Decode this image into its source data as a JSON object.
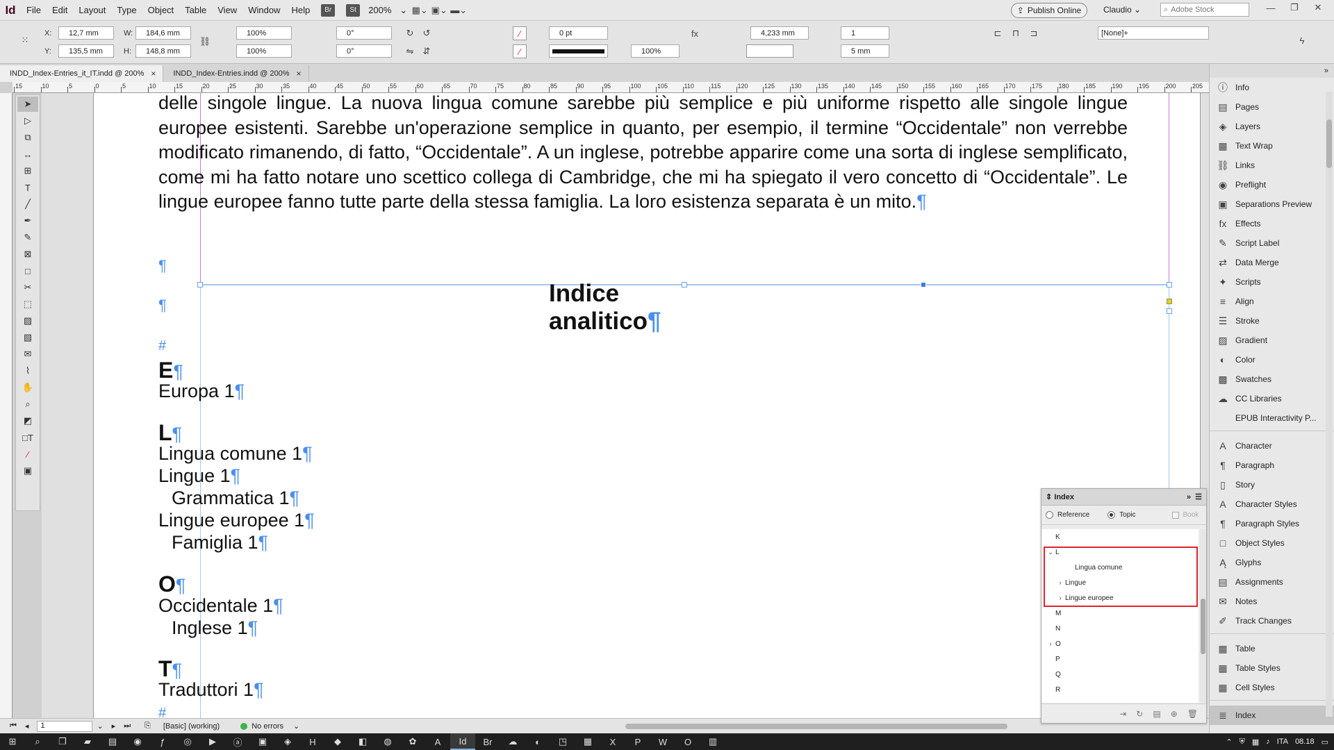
{
  "app": {
    "logo": "Id"
  },
  "menu": [
    "File",
    "Edit",
    "Layout",
    "Type",
    "Object",
    "Table",
    "View",
    "Window",
    "Help"
  ],
  "menubar": {
    "badge_br": "Br",
    "badge_st": "St",
    "zoom": "200%",
    "publish": "Publish Online",
    "user": "Claudio",
    "stock_placeholder": "Adobe Stock"
  },
  "control": {
    "x_label": "X:",
    "x": "12,7 mm",
    "y_label": "Y:",
    "y": "135,5 mm",
    "w_label": "W:",
    "w": "184,6 mm",
    "h_label": "H:",
    "h": "148,8 mm",
    "scale_x": "100%",
    "scale_y": "100%",
    "rotate": "0°",
    "shear": "0°",
    "stroke_weight": "0 pt",
    "opacity": "100%",
    "gutter": "4,233 mm",
    "columns": "1",
    "col_gap": "5 mm",
    "object_style": "[None]+"
  },
  "tabs": [
    {
      "label": "INDD_Index-Entries_it_IT.indd @ 200%",
      "close": "×"
    },
    {
      "label": "INDD_Index-Entries.indd @ 200%",
      "close": "×"
    }
  ],
  "ruler": [
    "15",
    "10",
    "5",
    "0",
    "5",
    "10",
    "15",
    "20",
    "25",
    "30",
    "35",
    "40",
    "45",
    "50",
    "55",
    "60",
    "65",
    "70",
    "75",
    "80",
    "85",
    "90",
    "95",
    "100",
    "105",
    "110",
    "115",
    "120",
    "125",
    "130",
    "135",
    "140",
    "145",
    "150",
    "155",
    "160",
    "165",
    "170",
    "175",
    "180",
    "185",
    "190",
    "195",
    "200",
    "205",
    "210"
  ],
  "document": {
    "paragraph": "delle singole lingue. La nuova lingua comune sarebbe più semplice e più uniforme rispetto alle singole lingue europee esistenti. Sarebbe un'operazione semplice in quanto, per esempio, il termine “Occidentale” non verrebbe modificato rimanendo, di fatto, “Occidentale”. A un inglese, potrebbe apparire come una sorta di inglese semplificato, come mi ha fatto notare uno scettico collega di Cambridge, che mi ha spiegato il vero concetto di “Occidentale”. Le lingue europee fanno tutte parte della stessa famiglia. La loro esistenza separata è un mito.",
    "pilcrow": "¶",
    "hash": "#",
    "index_title": "Indice analitico",
    "entries": [
      {
        "text": "E",
        "type": "letter"
      },
      {
        "text": "Europa  1",
        "type": "entry"
      },
      {
        "text": "L",
        "type": "letter"
      },
      {
        "text": "Lingua comune  1",
        "type": "entry"
      },
      {
        "text": "Lingue  1",
        "type": "entry"
      },
      {
        "text": "Grammatica  1",
        "type": "sub"
      },
      {
        "text": "Lingue europee  1",
        "type": "entry"
      },
      {
        "text": "Famiglia  1",
        "type": "sub"
      },
      {
        "text": "O",
        "type": "letter"
      },
      {
        "text": "Occidentale  1",
        "type": "entry"
      },
      {
        "text": "Inglese  1",
        "type": "sub"
      },
      {
        "text": "T",
        "type": "letter"
      },
      {
        "text": "Traduttori  1",
        "type": "entry"
      }
    ]
  },
  "status": {
    "page": "1",
    "style": "[Basic] (working)",
    "errors": "No errors"
  },
  "dock": {
    "group1": [
      "Info",
      "Pages",
      "Layers",
      "Text Wrap",
      "Links",
      "Preflight",
      "Separations Preview",
      "Effects",
      "Script Label",
      "Data Merge",
      "Scripts",
      "Align",
      "Stroke",
      "Gradient",
      "Color",
      "Swatches",
      "CC Libraries",
      "EPUB Interactivity P..."
    ],
    "group2": [
      "Character",
      "Paragraph",
      "Story",
      "Character Styles",
      "Paragraph Styles",
      "Object Styles",
      "Glyphs",
      "Assignments",
      "Notes",
      "Track Changes"
    ],
    "group3": [
      "Table",
      "Table Styles",
      "Cell Styles"
    ],
    "group4": [
      "Index"
    ],
    "icons": {
      "Info": "ⓘ",
      "Pages": "▤",
      "Layers": "◈",
      "Text Wrap": "▦",
      "Links": "⛓",
      "Preflight": "◉",
      "Separations Preview": "▣",
      "Effects": "fx",
      "Script Label": "✎",
      "Data Merge": "⇄",
      "Scripts": "✦",
      "Align": "≡",
      "Stroke": "☰",
      "Gradient": "▨",
      "Color": "◐",
      "Swatches": "▩",
      "CC Libraries": "☁",
      "EPUB Interactivity P...": "▭",
      "Character": "A",
      "Paragraph": "¶",
      "Story": "▯",
      "Character Styles": "A",
      "Paragraph Styles": "¶",
      "Object Styles": "□",
      "Glyphs": "Ą",
      "Assignments": "▤",
      "Notes": "✉",
      "Track Changes": "✐",
      "Table": "▦",
      "Table Styles": "▦",
      "Cell Styles": "▦",
      "Index": "≣"
    }
  },
  "index_panel": {
    "title": "Index",
    "reference": "Reference",
    "topic": "Topic",
    "book": "Book",
    "rows": [
      {
        "label": "K",
        "level": 0,
        "caret": ""
      },
      {
        "label": "L",
        "level": 0,
        "caret": "⌄"
      },
      {
        "label": "Lingua comune",
        "level": 2,
        "caret": ""
      },
      {
        "label": "Lingue",
        "level": 1,
        "caret": "›"
      },
      {
        "label": "Lingue europee",
        "level": 1,
        "caret": "›"
      },
      {
        "label": "M",
        "level": 0,
        "caret": ""
      },
      {
        "label": "N",
        "level": 0,
        "caret": ""
      },
      {
        "label": "O",
        "level": 0,
        "caret": "›"
      },
      {
        "label": "P",
        "level": 0,
        "caret": ""
      },
      {
        "label": "Q",
        "level": 0,
        "caret": ""
      },
      {
        "label": "R",
        "level": 0,
        "caret": ""
      }
    ]
  },
  "taskbar": {
    "lang": "ITA",
    "time": "08.18"
  },
  "colors": {
    "pilcrow": "#4a8ff0",
    "highlight": "#e0232b",
    "margin": "#c67bd3"
  }
}
